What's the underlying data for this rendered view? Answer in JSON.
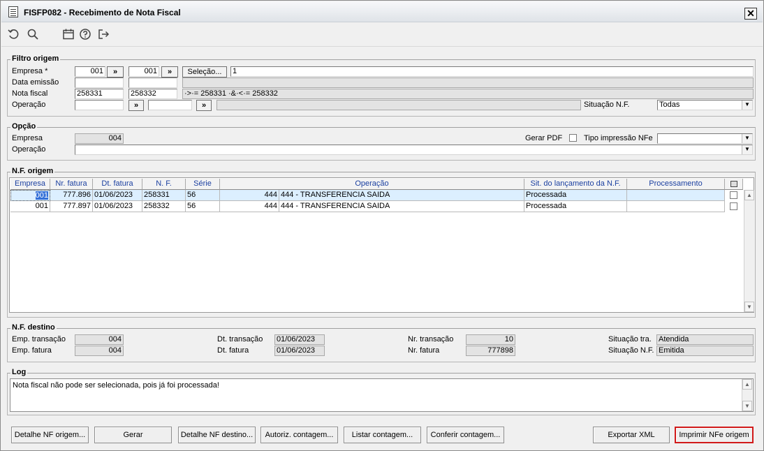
{
  "window": {
    "title": "FISFP082 - Recebimento de Nota Fiscal",
    "close_label": "✕"
  },
  "toolbar": {
    "icons": [
      "undo-icon",
      "search-icon",
      "calendar-icon",
      "help-icon",
      "exit-icon"
    ]
  },
  "filtro": {
    "title": "Filtro origem",
    "empresa_label": "Empresa *",
    "empresa_from": "001",
    "empresa_to": "001",
    "lookup_label": "»",
    "selecao_label": "Seleção...",
    "selecao_value": "1",
    "data_emissao_label": "Data emissão",
    "data_emissao_from": "",
    "data_emissao_to": "",
    "nota_fiscal_label": "Nota fiscal",
    "nota_from": "258331",
    "nota_to": "258332",
    "nota_expr": "·>·= 258331 ·&·<·= 258332",
    "operacao_label": "Operação",
    "operacao_from": "",
    "operacao_to": "",
    "situacao_label": "Situação N.F.",
    "situacao_value": "Todas"
  },
  "opcao": {
    "title": "Opção",
    "empresa_label": "Empresa",
    "empresa_value": "004",
    "gerar_pdf_label": "Gerar PDF",
    "tipo_impressao_label": "Tipo impressão NFe",
    "tipo_impressao_value": "",
    "operacao_label": "Operação",
    "operacao_value": ""
  },
  "nf_origem": {
    "title": "N.F. origem",
    "columns": [
      "Empresa",
      "Nr. fatura",
      "Dt. fatura",
      "N. F.",
      "Série",
      "Operação",
      "Sit. do lançamento da N.F.",
      "Processamento"
    ],
    "rows": [
      {
        "empresa": "001",
        "nr_fatura": "777.896",
        "dt_fatura": "01/06/2023",
        "nf": "258331",
        "serie": "56",
        "op_code": "444",
        "operacao": "444 - TRANSFERENCIA SAIDA",
        "situacao": "Processada",
        "processamento": ""
      },
      {
        "empresa": "001",
        "nr_fatura": "777.897",
        "dt_fatura": "01/06/2023",
        "nf": "258332",
        "serie": "56",
        "op_code": "444",
        "operacao": "444 - TRANSFERENCIA SAIDA",
        "situacao": "Processada",
        "processamento": ""
      }
    ]
  },
  "nf_destino": {
    "title": "N.F. destino",
    "emp_transacao_label": "Emp. transação",
    "emp_transacao": "004",
    "emp_fatura_label": "Emp. fatura",
    "emp_fatura": "004",
    "dt_transacao_label": "Dt. transação",
    "dt_transacao": "01/06/2023",
    "dt_fatura_label": "Dt. fatura",
    "dt_fatura": "01/06/2023",
    "nr_transacao_label": "Nr. transação",
    "nr_transacao": "10",
    "nr_fatura_label": "Nr. fatura",
    "nr_fatura": "777898",
    "situacao_tra_label": "Situação tra.",
    "situacao_tra": "Atendida",
    "situacao_nf_label": "Situação N.F.",
    "situacao_nf": "Emitida"
  },
  "log": {
    "title": "Log",
    "message": "Nota fiscal não pode ser selecionada, pois já foi processada!"
  },
  "buttons": {
    "detalhe_origem": "Detalhe NF origem...",
    "gerar": "Gerar",
    "detalhe_destino": "Detalhe NF destino...",
    "autoriz": "Autoriz. contagem...",
    "listar": "Listar contagem...",
    "conferir": "Conferir contagem...",
    "exportar": "Exportar XML",
    "imprimir": "Imprimir NFe origem"
  },
  "colors": {
    "highlight_border": "#d11a1a",
    "header_text": "#1a3fa0",
    "selected_row": "#dcefff"
  }
}
